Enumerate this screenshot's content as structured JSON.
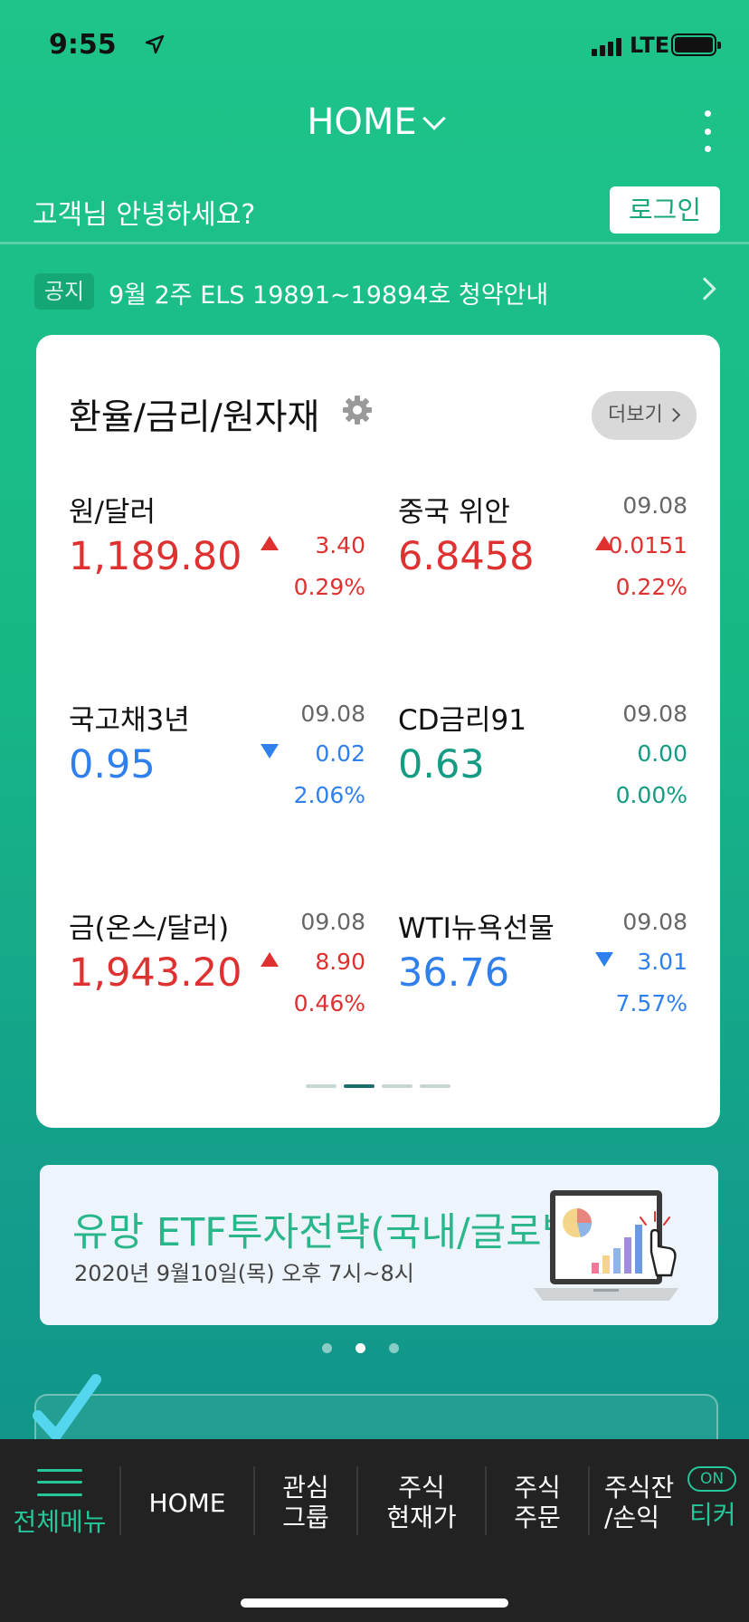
{
  "status_bar": {
    "time": "9:55",
    "network": "LTE"
  },
  "header": {
    "title": "HOME"
  },
  "greeting": {
    "text": "고객님 안녕하세요?",
    "login_label": "로그인"
  },
  "notice": {
    "badge": "공지",
    "text": "9월 2주 ELS 19891~19894호 청약안내"
  },
  "rates_card": {
    "title": "환율/금리/원자재",
    "more_label": "더보기",
    "items": [
      {
        "name": "원/달러",
        "date": "",
        "price": "1,189.80",
        "change": "3.40",
        "percent": "0.29%",
        "direction": "up"
      },
      {
        "name": "중국 위안",
        "date": "09.08",
        "price": "6.8458",
        "change": "0.0151",
        "percent": "0.22%",
        "direction": "up"
      },
      {
        "name": "국고채3년",
        "date": "09.08",
        "price": "0.95",
        "change": "0.02",
        "percent": "2.06%",
        "direction": "down"
      },
      {
        "name": "CD금리91",
        "date": "09.08",
        "price": "0.63",
        "change": "0.00",
        "percent": "0.00%",
        "direction": "flat"
      },
      {
        "name": "금(온스/달러)",
        "date": "09.08",
        "price": "1,943.20",
        "change": "8.90",
        "percent": "0.46%",
        "direction": "up"
      },
      {
        "name": "WTI뉴욕선물",
        "date": "09.08",
        "price": "36.76",
        "change": "3.01",
        "percent": "7.57%",
        "direction": "down"
      }
    ],
    "page_count": 4,
    "active_page": 2
  },
  "banner": {
    "title": "유망 ETF투자전략(국내/글로벌)",
    "subtitle": "2020년 9월10일(목) 오후 7시~8시",
    "dot_count": 3,
    "active_dot": 2
  },
  "bottom_nav": {
    "menu_label": "전체메뉴",
    "home_label": "HOME",
    "watch_line1": "관심",
    "watch_line2": "그룹",
    "price_line1": "주식",
    "price_line2": "현재가",
    "order_line1": "주식",
    "order_line2": "주문",
    "balance_line1": "주식잔",
    "balance_line2": "/손익",
    "on_badge": "ON",
    "ticker_label": "티커"
  },
  "colors": {
    "up": "#e03131",
    "down": "#2f80ed",
    "flat": "#149b83",
    "accent": "#25c79a"
  }
}
